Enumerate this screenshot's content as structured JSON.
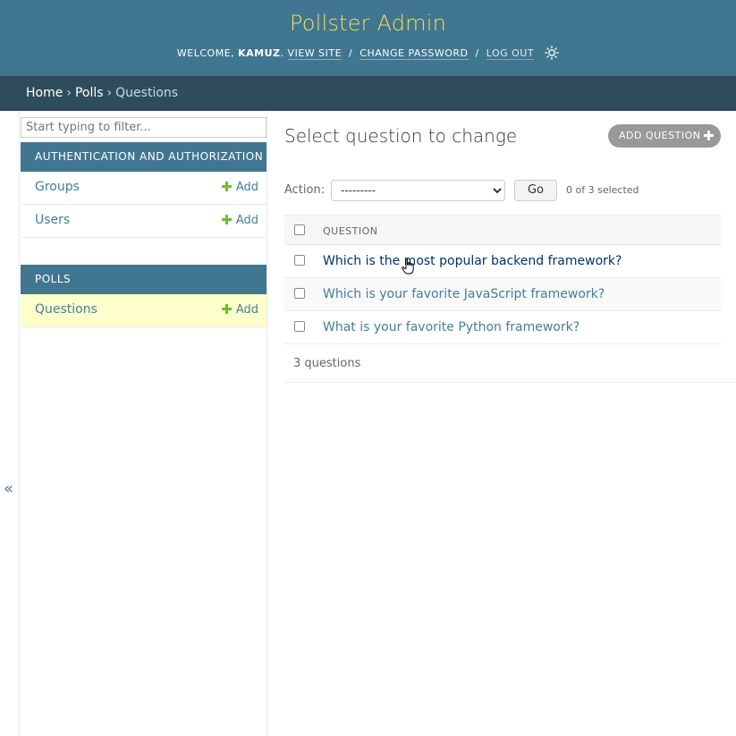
{
  "header": {
    "site_title": "Pollster Admin",
    "welcome": "WELCOME,",
    "username": "KAMUZ",
    "view_site": "VIEW SITE",
    "change_password": "CHANGE PASSWORD",
    "log_out": "LOG OUT",
    "separator": "/",
    "theme_icon": "sun-icon"
  },
  "breadcrumbs": {
    "home": "Home",
    "app": "Polls",
    "current": "Questions",
    "separator": "›"
  },
  "sidebar": {
    "filter_placeholder": "Start typing to filter...",
    "apps": [
      {
        "caption": "AUTHENTICATION AND AUTHORIZATION",
        "models": [
          {
            "label": "Groups",
            "add_label": "Add"
          },
          {
            "label": "Users",
            "add_label": "Add"
          }
        ]
      },
      {
        "caption": "POLLS",
        "models": [
          {
            "label": "Questions",
            "add_label": "Add",
            "selected": true
          }
        ]
      }
    ],
    "collapse_label": "«"
  },
  "main": {
    "title": "Select question to change",
    "add_button_label": "ADD QUESTION",
    "action_label": "Action:",
    "action_selected": "---------",
    "go_label": "Go",
    "selected_count": "0 of 3 selected",
    "column_header": "QUESTION",
    "rows": [
      "Which is the most popular backend framework?",
      "Which is your favorite JavaScript framework?",
      "What is your favorite Python framework?"
    ],
    "result_count": "3 questions"
  },
  "colors": {
    "header_bg": "#417690",
    "breadcrumb_bg": "#2f4c5b",
    "title_yellow": "#f5dd5d",
    "link": "#447e9b",
    "add_green": "#70bf2b",
    "selected_row": "#ffffcc"
  }
}
